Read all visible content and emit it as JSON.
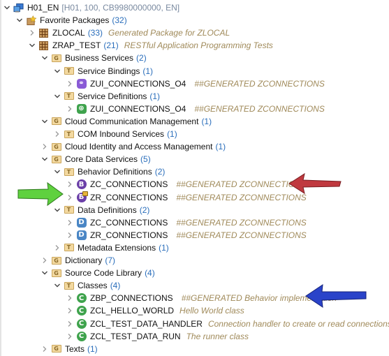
{
  "colors": {
    "count": "#2a6ebb",
    "description": "#a08a5a",
    "arrow_red": "#c0393f",
    "arrow_green": "#5fd13f",
    "arrow_blue": "#2a43c9",
    "binding_purple": "#8a5bd6",
    "service_green": "#3fa34d",
    "behavior_purple": "#6b3fa8",
    "ddl_blue": "#4a86c5",
    "class_green": "#3fa34d"
  },
  "tree": [
    {
      "id": "system",
      "level": 0,
      "expanded": true,
      "icon": "system-icon",
      "name": "H01_EN",
      "extra": "[H01, 100, CB9980000000, EN]"
    },
    {
      "id": "favorite-packages",
      "level": 1,
      "expanded": true,
      "icon": "favorites-icon",
      "name": "Favorite Packages",
      "count": "(32)"
    },
    {
      "id": "zlocal",
      "level": 2,
      "expanded": false,
      "icon": "package-icon",
      "name": "ZLOCAL",
      "count": "(33)",
      "desc": "Generated Package for ZLOCAL"
    },
    {
      "id": "zrap-test",
      "level": 2,
      "expanded": true,
      "icon": "package-icon",
      "name": "ZRAP_TEST",
      "count": "(21)",
      "desc": "RESTful Application Programming Tests"
    },
    {
      "id": "business-services",
      "level": 3,
      "expanded": true,
      "icon": "group-folder-icon",
      "name": "Business Services",
      "count": "(2)"
    },
    {
      "id": "service-bindings",
      "level": 4,
      "expanded": true,
      "icon": "type-folder-icon",
      "name": "Service Bindings",
      "count": "(1)"
    },
    {
      "id": "srvb-zui",
      "level": 5,
      "expanded": false,
      "icon": "service-binding-icon",
      "name": "ZUI_CONNECTIONS_O4",
      "desc": "##GENERATED ZCONNECTIONS"
    },
    {
      "id": "service-definitions",
      "level": 4,
      "expanded": true,
      "icon": "type-folder-icon",
      "name": "Service Definitions",
      "count": "(1)"
    },
    {
      "id": "srvd-zui",
      "level": 5,
      "expanded": false,
      "icon": "service-definition-icon",
      "name": "ZUI_CONNECTIONS_O4",
      "desc": "##GENERATED ZCONNECTIONS"
    },
    {
      "id": "cloud-comm",
      "level": 3,
      "expanded": true,
      "icon": "group-folder-icon",
      "name": "Cloud Communication Management",
      "count": "(1)"
    },
    {
      "id": "com-inbound",
      "level": 4,
      "expanded": false,
      "icon": "type-folder-icon",
      "name": "COM Inbound Services",
      "count": "(1)"
    },
    {
      "id": "cloud-iam",
      "level": 3,
      "expanded": false,
      "icon": "group-folder-icon",
      "name": "Cloud Identity and Access Management",
      "count": "(1)"
    },
    {
      "id": "cds",
      "level": 3,
      "expanded": true,
      "icon": "group-folder-icon",
      "name": "Core Data Services",
      "count": "(5)"
    },
    {
      "id": "behavior-defs",
      "level": 4,
      "expanded": true,
      "icon": "type-folder-icon",
      "name": "Behavior Definitions",
      "count": "(2)"
    },
    {
      "id": "bdef-zc",
      "level": 5,
      "expanded": false,
      "icon": "behavior-definition-icon",
      "name": "ZC_CONNECTIONS",
      "desc": "##GENERATED ZCONNECTIONS"
    },
    {
      "id": "bdef-zr",
      "level": 5,
      "expanded": false,
      "icon": "behavior-definition-locked-icon",
      "name": "ZR_CONNECTIONS",
      "desc": "##GENERATED ZCONNECTIONS"
    },
    {
      "id": "data-defs",
      "level": 4,
      "expanded": true,
      "icon": "type-folder-icon",
      "name": "Data Definitions",
      "count": "(2)"
    },
    {
      "id": "ddl-zc",
      "level": 5,
      "expanded": false,
      "icon": "data-definition-icon",
      "name": "ZC_CONNECTIONS",
      "desc": "##GENERATED ZCONNECTIONS"
    },
    {
      "id": "ddl-zr",
      "level": 5,
      "expanded": false,
      "icon": "data-definition-icon",
      "name": "ZR_CONNECTIONS",
      "desc": "##GENERATED ZCONNECTIONS"
    },
    {
      "id": "metadata-ext",
      "level": 4,
      "expanded": false,
      "icon": "type-folder-icon",
      "name": "Metadata Extensions",
      "count": "(1)"
    },
    {
      "id": "dictionary",
      "level": 3,
      "expanded": false,
      "icon": "group-folder-icon",
      "name": "Dictionary",
      "count": "(7)"
    },
    {
      "id": "source-code-lib",
      "level": 3,
      "expanded": true,
      "icon": "group-folder-icon",
      "name": "Source Code Library",
      "count": "(4)"
    },
    {
      "id": "classes",
      "level": 4,
      "expanded": true,
      "icon": "type-folder-icon",
      "name": "Classes",
      "count": "(4)"
    },
    {
      "id": "class-zbp",
      "level": 5,
      "expanded": false,
      "icon": "class-icon",
      "name": "ZBP_CONNECTIONS",
      "desc": "##GENERATED Behavior implementation"
    },
    {
      "id": "class-hello",
      "level": 5,
      "expanded": false,
      "icon": "class-icon",
      "name": "ZCL_HELLO_WORLD",
      "desc": "Hello World class"
    },
    {
      "id": "class-handler",
      "level": 5,
      "expanded": false,
      "icon": "class-icon",
      "name": "ZCL_TEST_DATA_HANDLER",
      "desc": "Connection handler to create or read connections."
    },
    {
      "id": "class-run",
      "level": 5,
      "expanded": false,
      "icon": "class-icon",
      "name": "ZCL_TEST_DATA_RUN",
      "desc": "The runner class"
    },
    {
      "id": "texts",
      "level": 3,
      "expanded": false,
      "icon": "group-folder-icon",
      "name": "Texts",
      "count": "(1)"
    }
  ],
  "annotations": [
    {
      "id": "red-arrow",
      "points_to": "bdef-zc",
      "color": "red"
    },
    {
      "id": "green-arrow",
      "points_to": "bdef-zr",
      "color": "green"
    },
    {
      "id": "blue-arrow",
      "points_to": "class-zbp",
      "color": "blue"
    }
  ]
}
